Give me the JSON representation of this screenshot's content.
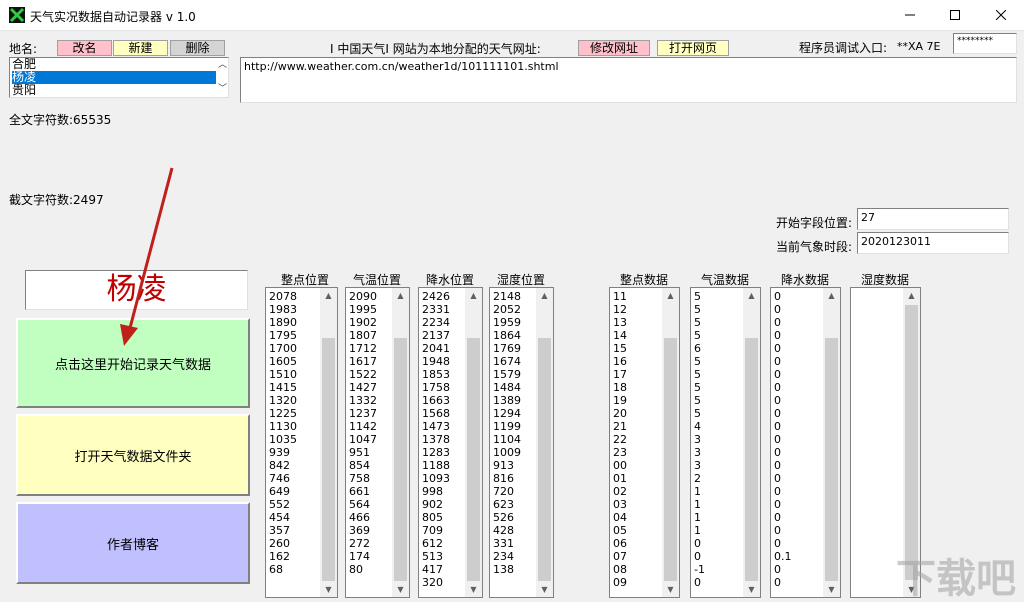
{
  "window": {
    "title": "天气实况数据自动记录器 v 1.0",
    "minimize_icon": "minimize-icon",
    "maximize_icon": "maximize-icon",
    "close_icon": "close-icon"
  },
  "location": {
    "label": "地名:",
    "rename_label": "改名",
    "new_label": "新建",
    "delete_label": "删除",
    "items": [
      "合肥",
      "杨凌",
      "贵阳"
    ],
    "selected": "杨凌"
  },
  "site": {
    "label": "I 中国天气I 网站为本地分配的天气网址:",
    "modify_label": "修改网址",
    "open_label": "打开网页",
    "url": "http://www.weather.com.cn/weather1d/101111101.shtml"
  },
  "debug": {
    "label": "程序员调试入口:",
    "code": "**XA 7E",
    "password": "********"
  },
  "stats": {
    "full_label": "全文字符数:",
    "full_count": "65535",
    "cut_label": "截文字符数:",
    "cut_count": "2497"
  },
  "fields": {
    "start_label": "开始字段位置:",
    "start_value": "27",
    "time_label": "当前气象时段:",
    "time_value": "2020123011"
  },
  "city_display": "杨凌",
  "buttons": {
    "start_record": "点击这里开始记录天气数据",
    "open_folder": "打开天气数据文件夹",
    "blog": "作者博客"
  },
  "colors": {
    "start_record_bg": "#c0ffc0",
    "open_folder_bg": "#ffffc0",
    "blog_bg": "#c0c0ff",
    "city_text": "#c00000",
    "selection": "#0078d7",
    "arrow": "#c0201a"
  },
  "columns": [
    {
      "header": "整点位置",
      "values": [
        "2078",
        "1983",
        "1890",
        "1795",
        "1700",
        "1605",
        "1510",
        "1415",
        "1320",
        "1225",
        "1130",
        "1035",
        "939",
        "842",
        "746",
        "649",
        "552",
        "454",
        "357",
        "260",
        "162",
        "68"
      ]
    },
    {
      "header": "气温位置",
      "values": [
        "2090",
        "1995",
        "1902",
        "1807",
        "1712",
        "1617",
        "1522",
        "1427",
        "1332",
        "1237",
        "1142",
        "1047",
        "951",
        "854",
        "758",
        "661",
        "564",
        "466",
        "369",
        "272",
        "174",
        "80"
      ]
    },
    {
      "header": "降水位置",
      "values": [
        "2426",
        "2331",
        "2234",
        "2137",
        "2041",
        "1948",
        "1853",
        "1758",
        "1663",
        "1568",
        "1473",
        "1378",
        "1283",
        "1188",
        "1093",
        "998",
        "902",
        "805",
        "709",
        "612",
        "513",
        "417",
        "320"
      ]
    },
    {
      "header": "湿度位置",
      "values": [
        "2148",
        "2052",
        "1959",
        "1864",
        "1769",
        "1674",
        "1579",
        "1484",
        "1389",
        "1294",
        "1199",
        "1104",
        "1009",
        "913",
        "816",
        "720",
        "623",
        "526",
        "428",
        "331",
        "234",
        "138"
      ]
    },
    {
      "header": "整点数据",
      "values": [
        "11",
        "12",
        "13",
        "14",
        "15",
        "16",
        "17",
        "18",
        "19",
        "20",
        "21",
        "22",
        "23",
        "00",
        "01",
        "02",
        "03",
        "04",
        "05",
        "06",
        "07",
        "08",
        "09"
      ]
    },
    {
      "header": "气温数据",
      "values": [
        "5",
        "5",
        "5",
        "5",
        "6",
        "5",
        "5",
        "5",
        "5",
        "5",
        "4",
        "3",
        "3",
        "3",
        "2",
        "1",
        "1",
        "1",
        "1",
        "0",
        "0",
        "-1",
        "0"
      ]
    },
    {
      "header": "降水数据",
      "values": [
        "0",
        "0",
        "0",
        "0",
        "0",
        "0",
        "0",
        "0",
        "0",
        "0",
        "0",
        "0",
        "0",
        "0",
        "0",
        "0",
        "0",
        "0",
        "0",
        "0",
        "0.1",
        "0",
        "0"
      ]
    },
    {
      "header": "湿度数据",
      "values": []
    }
  ],
  "watermark": "下载吧"
}
